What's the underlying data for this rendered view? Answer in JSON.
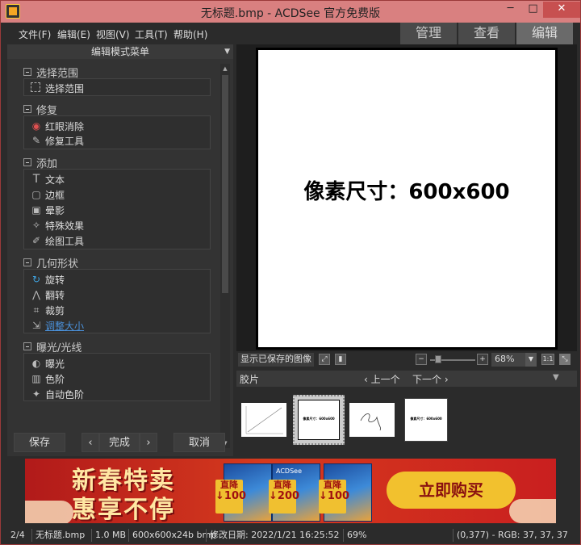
{
  "window": {
    "title": "无标题.bmp - ACDSee 官方免费版",
    "minimize": "─",
    "maximize": "□",
    "close": "✕"
  },
  "menubar": {
    "file": "文件(F)",
    "edit": "编辑(E)",
    "view": "视图(V)",
    "tools": "工具(T)",
    "help": "帮助(H)"
  },
  "modetabs": {
    "manage": "管理",
    "view": "查看",
    "edit": "编辑",
    "active": "编辑"
  },
  "leftpanel": {
    "header": "编辑模式菜单",
    "sections": [
      {
        "title": "选择范围",
        "items": [
          {
            "label": "选择范围",
            "icon": "selection-icon"
          }
        ]
      },
      {
        "title": "修复",
        "items": [
          {
            "label": "红眼消除",
            "icon": "eye-icon"
          },
          {
            "label": "修复工具",
            "icon": "bandage-icon"
          }
        ]
      },
      {
        "title": "添加",
        "items": [
          {
            "label": "文本",
            "icon": "text-icon"
          },
          {
            "label": "边框",
            "icon": "border-icon"
          },
          {
            "label": "晕影",
            "icon": "vignette-icon"
          },
          {
            "label": "特殊效果",
            "icon": "wand-icon"
          },
          {
            "label": "绘图工具",
            "icon": "brush-icon"
          }
        ]
      },
      {
        "title": "几何形状",
        "items": [
          {
            "label": "旋转",
            "icon": "rotate-icon"
          },
          {
            "label": "翻转",
            "icon": "flip-icon"
          },
          {
            "label": "裁剪",
            "icon": "crop-icon"
          },
          {
            "label": "调整大小",
            "icon": "resize-icon"
          }
        ]
      },
      {
        "title": "曝光/光线",
        "items": [
          {
            "label": "曝光",
            "icon": "exposure-icon"
          },
          {
            "label": "色阶",
            "icon": "levels-icon"
          },
          {
            "label": "自动色阶",
            "icon": "auto-levels-icon"
          }
        ]
      }
    ],
    "buttons": {
      "save": "保存",
      "prev": "‹",
      "done": "完成",
      "next": "›",
      "cancel": "取消"
    }
  },
  "canvas": {
    "text": "像素尺寸：600x600"
  },
  "viewbar": {
    "show_saved": "显示已保存的图像",
    "zoom_minus": "−",
    "zoom_plus": "+",
    "zoom_value": "68%",
    "zoom_fraction": 0.68,
    "one_to_one": "1:1"
  },
  "filmstrip": {
    "label": "胶片",
    "prev": "‹ 上一个",
    "next": "下一个 ›",
    "thumbs": [
      "chart",
      "像素尺寸：600x600",
      "scribble",
      "像素尺寸：600x600"
    ],
    "selected_index": 1
  },
  "ad": {
    "line1": "新春特卖",
    "line2": "惠享不停",
    "brand": "ACDSee",
    "prices": [
      {
        "label": "直降",
        "value": "↓100"
      },
      {
        "label": "直降",
        "value": "↓200"
      },
      {
        "label": "直降",
        "value": "↓100"
      }
    ],
    "buy": "立即购买",
    "colors": {
      "background": "#c91f1f",
      "button": "#f2c12e",
      "text": "#ffe7a3"
    }
  },
  "status": {
    "index": "2/4",
    "filename": "无标题.bmp",
    "size": "1.0 MB",
    "dims": "600x600x24b bmp",
    "modified": "修改日期: 2022/1/21 16:25:52",
    "zoom": "69%",
    "pixel": "(0,377) - RGB: 37, 37, 37"
  }
}
